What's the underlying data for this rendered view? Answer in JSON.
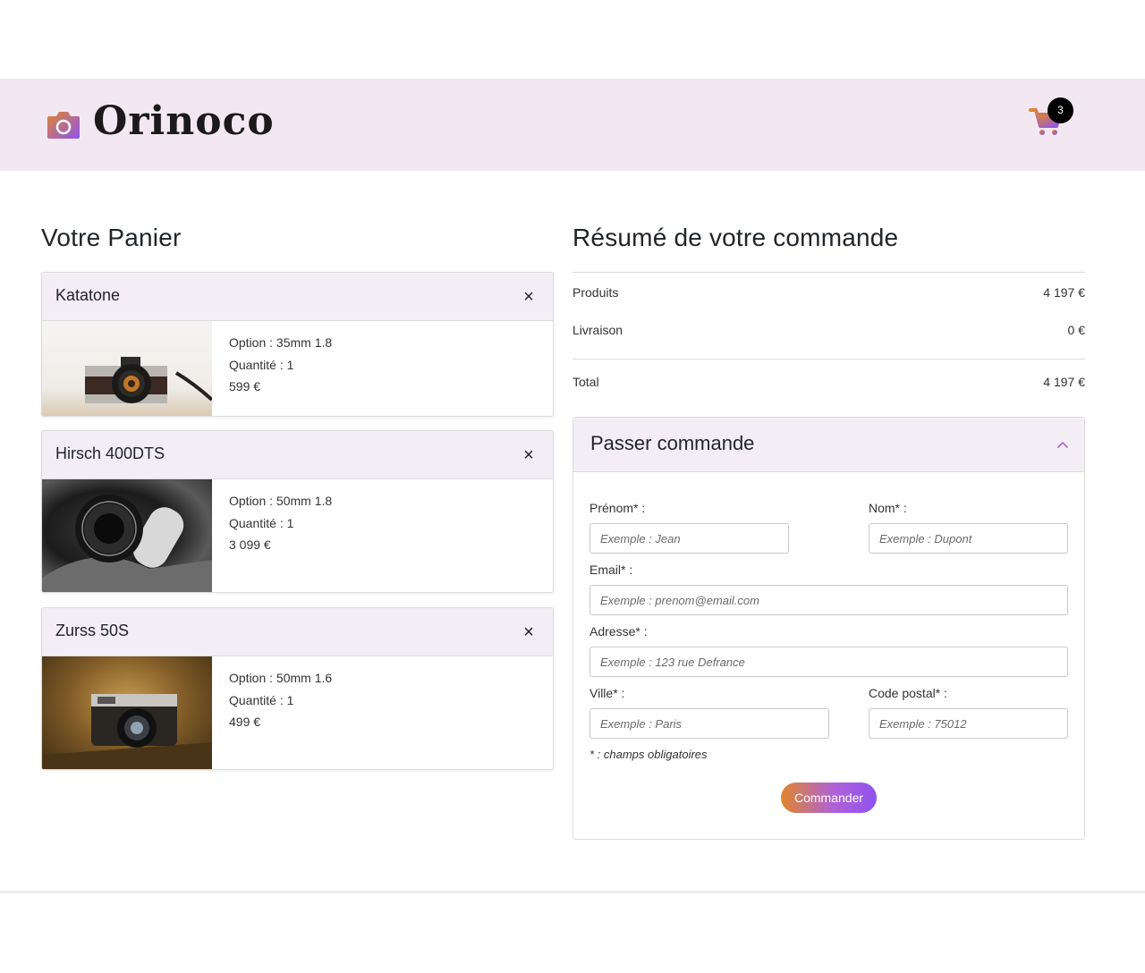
{
  "header": {
    "logo_text": "Orinoco",
    "cart_count": "3",
    "brand_gradient": [
      "#e0862c",
      "#8e53f0"
    ]
  },
  "cart": {
    "title": "Votre Panier",
    "items": [
      {
        "name": "Katatone",
        "option": "Option : 35mm 1.8",
        "quantity": "Quantité : 1",
        "price": "599 €"
      },
      {
        "name": "Hirsch 400DTS",
        "option": "Option : 50mm 1.8",
        "quantity": "Quantité : 1",
        "price": "3 099 €"
      },
      {
        "name": "Zurss 50S",
        "option": "Option : 50mm 1.6",
        "quantity": "Quantité : 1",
        "price": "499 €"
      }
    ],
    "remove_symbol": "×"
  },
  "summary": {
    "title": "Résumé de votre commande",
    "products_label": "Produits",
    "products_value": "4 197 €",
    "delivery_label": "Livraison",
    "delivery_value": "0 €",
    "total_label": "Total",
    "total_value": "4 197 €"
  },
  "order_form": {
    "title": "Passer commande",
    "firstname_label": "Prénom* :",
    "firstname_placeholder": "Exemple : Jean",
    "lastname_label": "Nom* :",
    "lastname_placeholder": "Exemple : Dupont",
    "email_label": "Email* :",
    "email_placeholder": "Exemple : prenom@email.com",
    "address_label": "Adresse* :",
    "address_placeholder": "Exemple : 123 rue Defrance",
    "city_label": "Ville* :",
    "city_placeholder": "Exemple : Paris",
    "zip_label": "Code postal* :",
    "zip_placeholder": "Exemple : 75012",
    "required_note": "* : champs obligatoires",
    "submit_label": "Commander"
  }
}
